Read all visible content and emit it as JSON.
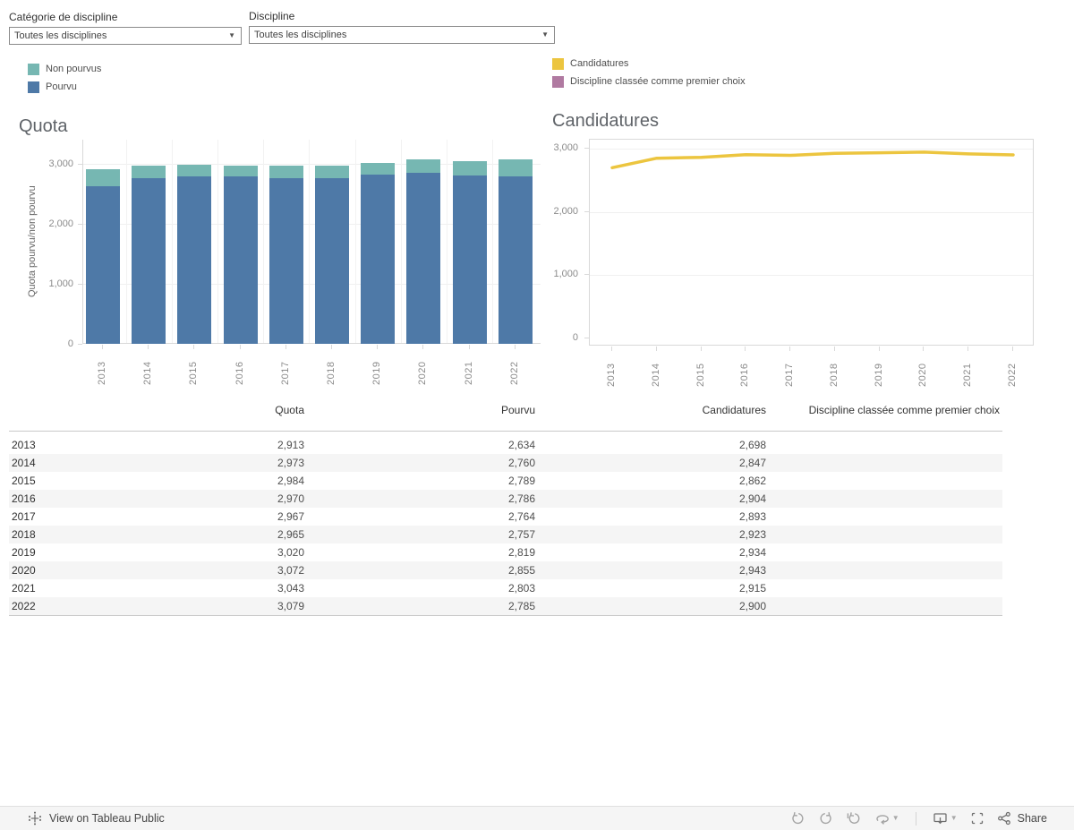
{
  "filters": [
    {
      "label": "Catégorie de discipline",
      "value": "Toutes les disciplines"
    },
    {
      "label": "Discipline",
      "value": "Toutes les disciplines"
    }
  ],
  "legends": {
    "quota": [
      {
        "label": "Non pourvus",
        "color": "#76b7b2"
      },
      {
        "label": "Pourvu",
        "color": "#4e79a7"
      }
    ],
    "candidatures": [
      {
        "label": "Candidatures",
        "color": "#ecc53f"
      },
      {
        "label": "Discipline classée comme premier choix",
        "color": "#b07aa1"
      }
    ]
  },
  "chart_data": [
    {
      "type": "bar",
      "stacked": true,
      "title": "Quota",
      "xlabel": "",
      "ylabel": "Quota pourvu/non pourvu",
      "categories": [
        "2013",
        "2014",
        "2015",
        "2016",
        "2017",
        "2018",
        "2019",
        "2020",
        "2021",
        "2022"
      ],
      "series": [
        {
          "name": "Pourvu",
          "color": "#4e79a7",
          "values": [
            2634,
            2760,
            2789,
            2786,
            2764,
            2757,
            2819,
            2855,
            2803,
            2785
          ]
        },
        {
          "name": "Non pourvus",
          "color": "#76b7b2",
          "values": [
            279,
            213,
            195,
            184,
            203,
            208,
            201,
            217,
            240,
            294
          ]
        }
      ],
      "totals": [
        2913,
        2973,
        2984,
        2970,
        2967,
        2965,
        3020,
        3072,
        3043,
        3079
      ],
      "ylim": [
        0,
        3400
      ],
      "ytick_values": [
        0,
        1000,
        2000,
        3000
      ],
      "ytick_labels": [
        "0",
        "1,000",
        "2,000",
        "3,000"
      ],
      "grid": true,
      "legend_position": "top-left"
    },
    {
      "type": "line",
      "title": "Candidatures",
      "xlabel": "",
      "ylabel": "",
      "categories": [
        "2013",
        "2014",
        "2015",
        "2016",
        "2017",
        "2018",
        "2019",
        "2020",
        "2021",
        "2022"
      ],
      "series": [
        {
          "name": "Candidatures",
          "color": "#ecc53f",
          "values": [
            2698,
            2847,
            2862,
            2904,
            2893,
            2923,
            2934,
            2943,
            2915,
            2900
          ]
        }
      ],
      "ylim": [
        0,
        3270
      ],
      "ytick_values": [
        0,
        1000,
        2000,
        3000
      ],
      "ytick_labels": [
        "0",
        "1,000",
        "2,000",
        "3,000"
      ],
      "grid": true,
      "legend_position": "top-right"
    }
  ],
  "table": {
    "columns": [
      "",
      "Quota",
      "Pourvu",
      "Candidatures",
      "Discipline classée comme premier choix"
    ],
    "rows": [
      {
        "year": "2013",
        "quota": "2,913",
        "pourvu": "2,634",
        "candidatures": "2,698",
        "premier_choix": ""
      },
      {
        "year": "2014",
        "quota": "2,973",
        "pourvu": "2,760",
        "candidatures": "2,847",
        "premier_choix": ""
      },
      {
        "year": "2015",
        "quota": "2,984",
        "pourvu": "2,789",
        "candidatures": "2,862",
        "premier_choix": ""
      },
      {
        "year": "2016",
        "quota": "2,970",
        "pourvu": "2,786",
        "candidatures": "2,904",
        "premier_choix": ""
      },
      {
        "year": "2017",
        "quota": "2,967",
        "pourvu": "2,764",
        "candidatures": "2,893",
        "premier_choix": ""
      },
      {
        "year": "2018",
        "quota": "2,965",
        "pourvu": "2,757",
        "candidatures": "2,923",
        "premier_choix": ""
      },
      {
        "year": "2019",
        "quota": "3,020",
        "pourvu": "2,819",
        "candidatures": "2,934",
        "premier_choix": ""
      },
      {
        "year": "2020",
        "quota": "3,072",
        "pourvu": "2,855",
        "candidatures": "2,943",
        "premier_choix": ""
      },
      {
        "year": "2021",
        "quota": "3,043",
        "pourvu": "2,803",
        "candidatures": "2,915",
        "premier_choix": ""
      },
      {
        "year": "2022",
        "quota": "3,079",
        "pourvu": "2,785",
        "candidatures": "2,900",
        "premier_choix": ""
      }
    ]
  },
  "toolbar": {
    "view_label": "View on Tableau Public",
    "share_label": "Share"
  }
}
